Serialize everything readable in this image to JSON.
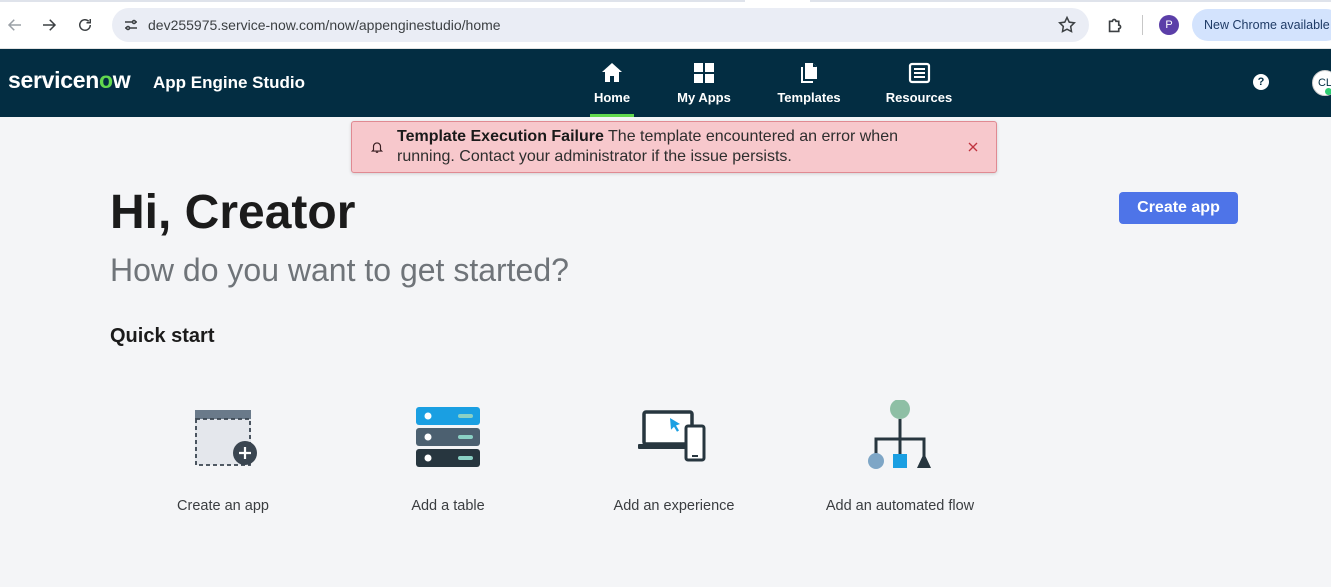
{
  "browser": {
    "url": "dev255975.service-now.com/now/appenginestudio/home",
    "profile_initial": "P",
    "update_label": "New Chrome available",
    "icons": [
      "back-icon",
      "forward-icon",
      "reload-icon",
      "site-info-icon",
      "bookmark-star-icon",
      "extensions-icon"
    ]
  },
  "header": {
    "logo_prefix": "servicen",
    "logo_o": "o",
    "logo_suffix": "w",
    "app_title": "App Engine Studio",
    "nav": [
      {
        "label": "Home",
        "icon": "home-icon",
        "active": true
      },
      {
        "label": "My Apps",
        "icon": "grid-icon",
        "active": false
      },
      {
        "label": "Templates",
        "icon": "documents-icon",
        "active": false
      },
      {
        "label": "Resources",
        "icon": "newspaper-icon",
        "active": false
      }
    ],
    "help_label": "?",
    "user_initials": "CL"
  },
  "toast": {
    "title": "Template Execution Failure",
    "message": "The template encountered an error when running. Contact your administrator if the issue persists."
  },
  "main": {
    "greeting": "Hi, Creator",
    "subtitle": "How do you want to get started?",
    "create_label": "Create app",
    "quick_start_title": "Quick start",
    "cards": [
      {
        "label": "Create an app",
        "icon": "app-window-plus-icon"
      },
      {
        "label": "Add a table",
        "icon": "database-table-icon"
      },
      {
        "label": "Add an experience",
        "icon": "laptop-phone-icon"
      },
      {
        "label": "Add an automated flow",
        "icon": "flow-diagram-icon"
      }
    ]
  },
  "colors": {
    "header_bg": "#032d42",
    "accent_green": "#62d84e",
    "primary_button": "#4e74e8",
    "toast_bg": "#f7c8cc"
  }
}
